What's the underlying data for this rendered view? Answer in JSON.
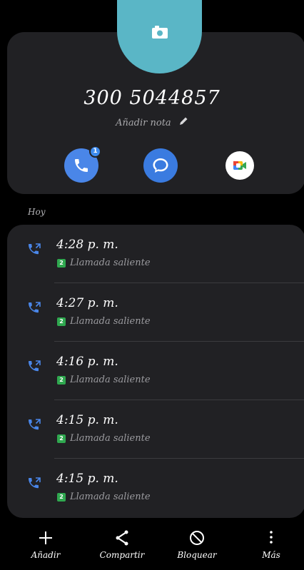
{
  "contact": {
    "number": "300 5044857",
    "add_note": "Añadir nota",
    "missed_badge": "1"
  },
  "actions": {
    "call_icon": "phone-icon",
    "message_icon": "message-bubble-icon",
    "video_icon": "google-meet-icon"
  },
  "section": {
    "label": "Hoy"
  },
  "call_log": [
    {
      "time": "4:28 p. m.",
      "sim": "2",
      "type": "Llamada saliente",
      "icon": "outgoing-call-icon"
    },
    {
      "time": "4:27 p. m.",
      "sim": "2",
      "type": "Llamada saliente",
      "icon": "outgoing-call-icon"
    },
    {
      "time": "4:16 p. m.",
      "sim": "2",
      "type": "Llamada saliente",
      "icon": "outgoing-call-icon"
    },
    {
      "time": "4:15 p. m.",
      "sim": "2",
      "type": "Llamada saliente",
      "icon": "outgoing-call-icon"
    },
    {
      "time": "4:15 p. m.",
      "sim": "2",
      "type": "Llamada saliente",
      "icon": "outgoing-call-icon"
    }
  ],
  "bottom_bar": {
    "add": "Añadir",
    "share": "Compartir",
    "block": "Bloquear",
    "more": "Más"
  },
  "colors": {
    "background": "#000000",
    "card": "#212124",
    "avatar": "#5ab6c6",
    "accent_blue": "#4a86e8",
    "sim_green": "#2fa84f"
  }
}
